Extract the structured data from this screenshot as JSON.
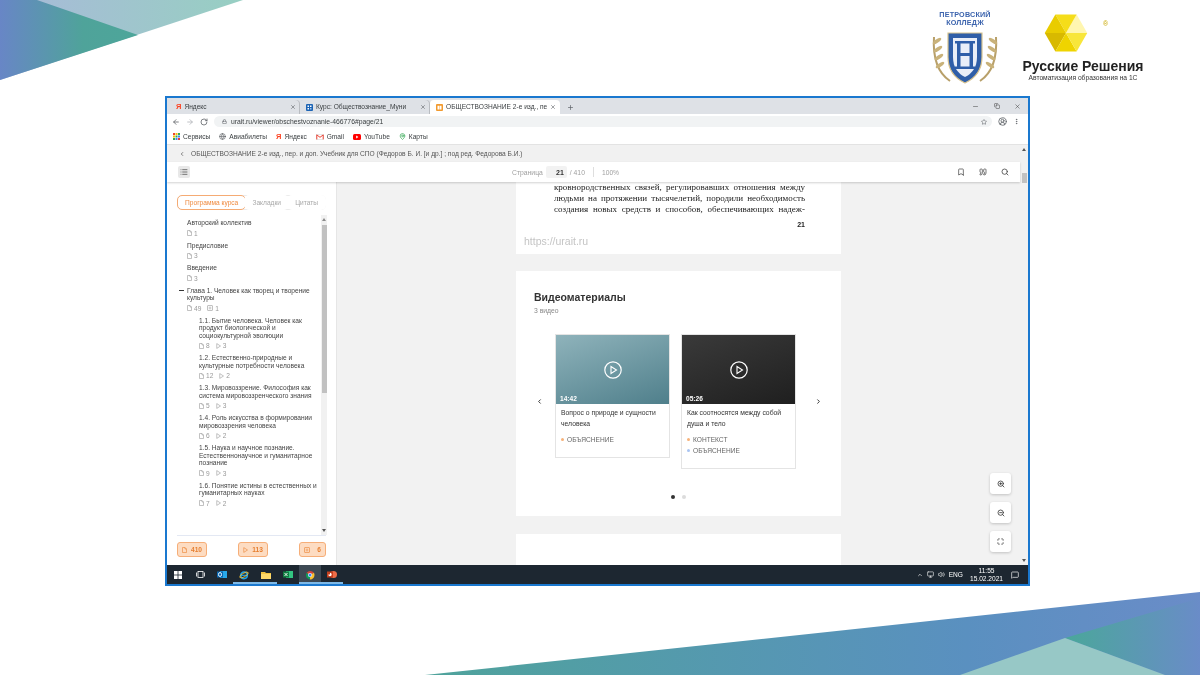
{
  "slide": {
    "college_logo": {
      "line_1": "ПЕТРОВСКИЙ",
      "line_2": "КОЛЛЕДЖ"
    },
    "company_logo": {
      "name": "Русские Решения",
      "tagline": "Автоматизация образования на 1С",
      "mark": "®"
    }
  },
  "browser": {
    "tabs": [
      {
        "kind": "letter",
        "favicon": "Я",
        "title": "Яндекс",
        "selected": false
      },
      {
        "kind": "tile",
        "title": "Курс: Обществознание_Муни",
        "selected": false
      },
      {
        "kind": "book",
        "title": "ОБЩЕСТВОЗНАНИЕ 2-е изд., пе",
        "selected": true
      }
    ],
    "address": "urait.ru/viewer/obschestvoznanie-466776#page/21",
    "bookmarks": [
      {
        "kind": "apps",
        "label": "Сервисы"
      },
      {
        "kind": "globe",
        "label": "Авиабилеты"
      },
      {
        "kind": "letter",
        "favicon": "Я",
        "label": "Яндекс"
      },
      {
        "kind": "mail",
        "label": "Gmail"
      },
      {
        "kind": "video",
        "label": "YouTube"
      },
      {
        "kind": "map",
        "label": "Карты"
      }
    ]
  },
  "reader": {
    "title": "ОБЩЕСТВОЗНАНИЕ 2-е изд., пер. и доп. Учебник для СПО (Федоров Б. И. [и др.] ; под ред. Федорова Б.И.)",
    "toolbar": {
      "page_label": "Страница",
      "page": "21",
      "page_total": "/ 410",
      "zoom": "100%"
    },
    "sidebar": {
      "tabs": [
        {
          "label": "Программа курса",
          "selected": true
        },
        {
          "label": "Закладки",
          "selected": false
        },
        {
          "label": "Цитаты",
          "selected": false
        }
      ],
      "contents": [
        {
          "title": "Авторский коллектив",
          "meta": [
            {
              "kind": "pages",
              "count": "1"
            }
          ]
        },
        {
          "title": "Предисловие",
          "meta": [
            {
              "kind": "pages",
              "count": "3"
            }
          ]
        },
        {
          "title": "Введение",
          "meta": [
            {
              "kind": "pages",
              "count": "3"
            }
          ]
        },
        {
          "title": "Глава 1. Человек как творец и творение культуры",
          "expanded": true,
          "meta": [
            {
              "kind": "pages",
              "count": "49"
            },
            {
              "kind": "tests",
              "count": "1"
            }
          ],
          "children": [
            {
              "title": "1.1. Бытие человека. Человек как продукт биологической и социокультурной эволюции",
              "meta": [
                {
                  "kind": "pages",
                  "count": "8"
                },
                {
                  "kind": "videos",
                  "count": "3"
                }
              ]
            },
            {
              "title": "1.2. Естественно-природные и культурные потребности человека",
              "meta": [
                {
                  "kind": "pages",
                  "count": "12"
                },
                {
                  "kind": "videos",
                  "count": "2"
                }
              ]
            },
            {
              "title": "1.3. Мировоззрение. Философия как система мировоззренческого знания",
              "meta": [
                {
                  "kind": "pages",
                  "count": "5"
                },
                {
                  "kind": "videos",
                  "count": "3"
                }
              ]
            },
            {
              "title": "1.4. Роль искусства в формировании мировоззрения человека",
              "meta": [
                {
                  "kind": "pages",
                  "count": "6"
                },
                {
                  "kind": "videos",
                  "count": "2"
                }
              ]
            },
            {
              "title": "1.5. Наука и научное познание. Естественнонаучное и гуманитарное познание",
              "meta": [
                {
                  "kind": "pages",
                  "count": "9"
                },
                {
                  "kind": "videos",
                  "count": "3"
                }
              ]
            },
            {
              "title": "1.6. Понятие истины в естественных и гуманитарных науках",
              "meta": [
                {
                  "kind": "pages",
                  "count": "7"
                },
                {
                  "kind": "videos",
                  "count": "2"
                }
              ]
            }
          ]
        }
      ],
      "counters": [
        {
          "kind": "pages",
          "count": "410"
        },
        {
          "kind": "videos",
          "count": "113"
        },
        {
          "kind": "tests",
          "count": "6"
        }
      ]
    },
    "page": {
      "lines": [
        "кровнородственных связей, регулировавших отношения между",
        "людьми на протяжении тысячелетий, породили необходимость",
        "создания новых средств и способов, обеспечивающих надеж-"
      ],
      "page_number": "21",
      "source": "https://urait.ru"
    },
    "videos": {
      "title": "Видеоматериалы",
      "count": "3 видео",
      "items": [
        {
          "duration": "14:42",
          "title": "Вопрос о природе и сущности человека",
          "tags": [
            {
              "label": "ОБЪЯСНЕНИЕ",
              "color": "#f7b27a"
            }
          ]
        },
        {
          "duration": "05:26",
          "title": "Как соотносятся между собой душа и тело",
          "tags": [
            {
              "label": "КОНТЕКСТ",
              "color": "#f7b27a"
            },
            {
              "label": "ОБЪЯСНЕНИЕ",
              "color": "#a9c4f2"
            }
          ]
        }
      ],
      "pages": [
        {
          "selected": true
        },
        {
          "selected": false
        }
      ]
    }
  },
  "taskbar": {
    "apps": [
      {
        "kind": "mail",
        "running": false,
        "selected": false
      },
      {
        "kind": "web",
        "running": true,
        "selected": false
      },
      {
        "kind": "folder",
        "running": true,
        "selected": false
      },
      {
        "kind": "sheet",
        "running": false,
        "selected": false
      },
      {
        "kind": "browser",
        "running": true,
        "selected": true
      },
      {
        "kind": "slides",
        "running": true,
        "selected": false
      }
    ],
    "language": "ENG",
    "time": "11:55",
    "date": "15.02.2021"
  }
}
